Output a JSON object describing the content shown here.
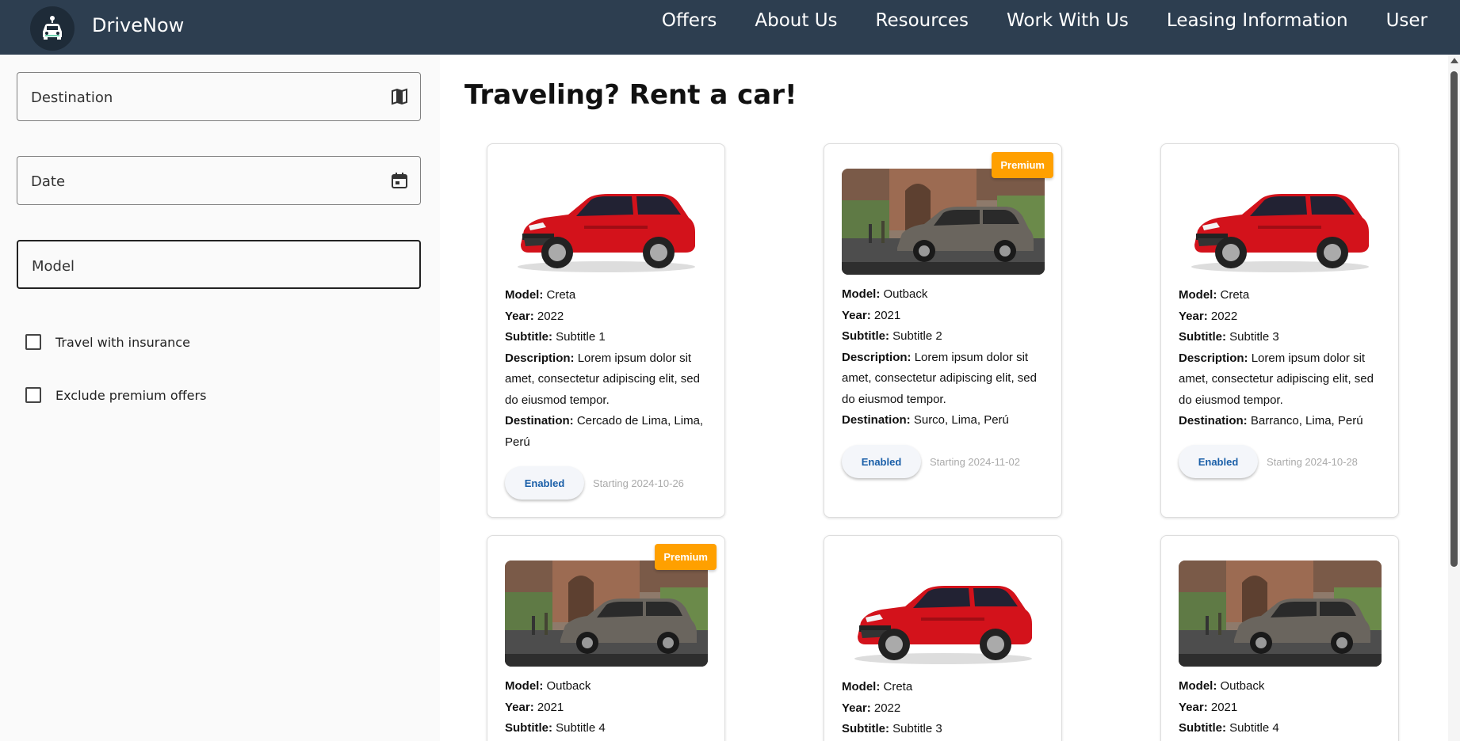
{
  "app": {
    "brand": "DriveNow",
    "nav": [
      "Offers",
      "About Us",
      "Resources",
      "Work With Us",
      "Leasing Information",
      "User"
    ]
  },
  "filters": {
    "destination_label": "Destination",
    "date_label": "Date",
    "model_label": "Model",
    "insurance_label": "Travel with insurance",
    "exclude_premium_label": "Exclude premium offers"
  },
  "main": {
    "title": "Traveling? Rent a car!"
  },
  "labels": {
    "model": "Model:",
    "year": "Year:",
    "subtitle": "Subtitle:",
    "description": "Description:",
    "destination": "Destination:"
  },
  "cards": [
    {
      "model": "Creta",
      "year": "2022",
      "subtitle": "Subtitle 1",
      "description": "Lorem ipsum dolor sit amet, consectetur adipiscing elit, sed do eiusmod tempor.",
      "destination": "Cercado de Lima, Lima, Perú",
      "status": "Enabled",
      "starting": "Starting 2024-10-26",
      "premium": "",
      "image": "red-suv"
    },
    {
      "model": "Outback",
      "year": "2021",
      "subtitle": "Subtitle 2",
      "description": "Lorem ipsum dolor sit amet, consectetur adipiscing elit, sed do eiusmod tempor.",
      "destination": "Surco, Lima, Perú",
      "status": "Enabled",
      "starting": "Starting 2024-11-02",
      "premium": "Premium",
      "image": "grey-suv-photo"
    },
    {
      "model": "Creta",
      "year": "2022",
      "subtitle": "Subtitle 3",
      "description": "Lorem ipsum dolor sit amet, consectetur adipiscing elit, sed do eiusmod tempor.",
      "destination": "Barranco, Lima, Perú",
      "status": "Enabled",
      "starting": "Starting 2024-10-28",
      "premium": "",
      "image": "red-suv"
    },
    {
      "model": "Outback",
      "year": "2021",
      "subtitle": "Subtitle 4",
      "premium": "Premium",
      "image": "grey-suv-photo"
    },
    {
      "model": "Creta",
      "year": "2022",
      "subtitle": "Subtitle 3",
      "premium": "",
      "image": "red-suv"
    },
    {
      "model": "Outback",
      "year": "2021",
      "subtitle": "Subtitle 4",
      "premium": "",
      "image": "grey-suv-photo"
    }
  ],
  "icons": {
    "logo": "car-logo-icon",
    "destination": "map-icon",
    "date": "calendar-icon"
  },
  "colors": {
    "navbar": "#2d3e50",
    "premium": "#ffa000",
    "status_text": "#1a5fa8"
  }
}
